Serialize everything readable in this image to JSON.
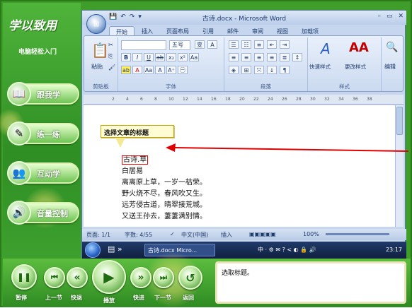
{
  "app": {
    "logo": "学以致用",
    "subtitle": "电脑轻松入门",
    "nav": [
      {
        "label": "跟我学",
        "icon": "book-icon"
      },
      {
        "label": "练一练",
        "icon": "pencil-icon"
      },
      {
        "label": "互动学",
        "icon": "people-icon"
      },
      {
        "label": "音量控制",
        "icon": "speaker-icon"
      }
    ],
    "controls": [
      {
        "label": "暂停",
        "glyph": "❚❚"
      },
      {
        "label": "上一节",
        "glyph": "⏮"
      },
      {
        "label": "快退",
        "glyph": "«"
      },
      {
        "label": "播放",
        "glyph": "▶"
      },
      {
        "label": "快进",
        "glyph": "»"
      },
      {
        "label": "下一节",
        "glyph": "⏭"
      },
      {
        "label": "返回",
        "glyph": "↺"
      }
    ],
    "message": "选取标题。"
  },
  "word": {
    "title": "古诗.docx - Microsoft Word",
    "qat": [
      "💾",
      "↶",
      "↷",
      "▾"
    ],
    "win_buttons": [
      "–",
      "▭",
      "✕"
    ],
    "tabs": [
      "开始",
      "插入",
      "页面布局",
      "引用",
      "邮件",
      "审阅",
      "视图",
      "加载项"
    ],
    "active_tab": "开始",
    "ribbon": {
      "groups": [
        "剪贴板",
        "字体",
        "段落",
        "样式"
      ],
      "paste_label": "粘贴",
      "font_size": "五号",
      "quick_style": "快速样式",
      "change_style": "更改样式",
      "edit": "编辑"
    },
    "ruler_ticks": [
      "2",
      "4",
      "6",
      "8",
      "10",
      "12",
      "14",
      "16",
      "18",
      "20",
      "22",
      "24",
      "26",
      "28",
      "30",
      "32",
      "34",
      "36",
      "38"
    ],
    "callout": "选择文章的标题",
    "document_lines": [
      "古诗.草",
      "白居易",
      "离离原上草，一岁一枯荣。",
      "野火烧不尽，春风吹又生。",
      "远芳侵古道，晴翠接荒城。",
      "又送王孙去，萋萋满别情。"
    ],
    "status": {
      "page": "页面: 1/1",
      "words": "字数: 4/55",
      "language": "中文(中国)",
      "insert": "插入",
      "zoom": "100%"
    },
    "taskbar": {
      "item": "古诗.docx  Micro...",
      "tray": "中 · ⚙ ✉ ? < ◐ 🔒 🔊",
      "clock": "23:17"
    }
  },
  "colors": {
    "frame_green": "#3f9d2a",
    "ribbon_blue": "#cbdaf0",
    "arrow_red": "#e00000"
  }
}
